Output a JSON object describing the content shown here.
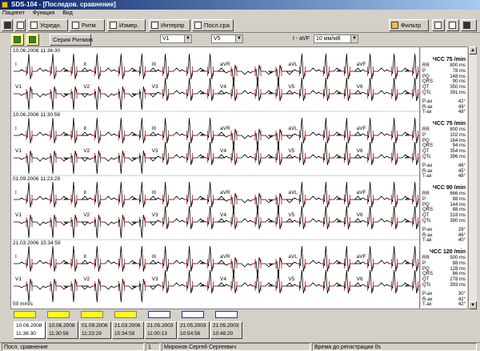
{
  "window": {
    "title": "SDS-104 - [Последов. сравнение]"
  },
  "menu": [
    "Пациент",
    "Функция",
    "Вид"
  ],
  "toolbar": {
    "btn_avg": "Усредн.",
    "btn_rhythm": "Ритм",
    "btn_measure": "Измер.",
    "btn_interpret": "Интерпр",
    "btn_seq": "Посл.сра",
    "btn_filter": "Фильтр"
  },
  "toolbar2": {
    "series_btn": "Серия Ритмов",
    "lead_a": "V1",
    "lead_b": "V5",
    "lead_range": "I - aVF",
    "gain": "10 мм/мВ"
  },
  "ecg": {
    "speed": "50 mm/s",
    "records": [
      {
        "date": "10.06.2008 11:36:30"
      },
      {
        "date": "10.06.2008 11:30:56"
      },
      {
        "date": "01.09.2006 11:23:29"
      },
      {
        "date": "21.03.2006 15:34:59"
      }
    ],
    "row_leads_top": [
      "I",
      "II",
      "III",
      "aVR",
      "aVL",
      "aVF"
    ],
    "row_leads_bottom": [
      "V1",
      "V2",
      "V3",
      "V4",
      "V5",
      "V6"
    ]
  },
  "measurements": [
    {
      "hr": "ЧСС  75 /min",
      "rows": [
        [
          "RR",
          "800 ms"
        ],
        [
          "P",
          "78 ms"
        ],
        [
          "PQ",
          "148 ms"
        ],
        [
          "QRS",
          "90 ms"
        ],
        [
          "QT",
          "350 ms"
        ],
        [
          "QTc",
          "391 ms"
        ]
      ],
      "axes": [
        [
          "P-ax",
          "42°"
        ],
        [
          "R-ax",
          "49°"
        ],
        [
          "T-ax",
          "48°"
        ]
      ]
    },
    {
      "hr": "ЧСС  75 /min",
      "rows": [
        [
          "RR",
          "800 ms"
        ],
        [
          "P",
          "102 ms"
        ],
        [
          "PQ",
          "164 ms"
        ],
        [
          "QRS",
          "94 ms"
        ],
        [
          "QT",
          "354 ms"
        ],
        [
          "QTc",
          "396 ms"
        ]
      ],
      "axes": [
        [
          "P-ax",
          "46°"
        ],
        [
          "R-ax",
          "45°"
        ],
        [
          "T-ax",
          "48°"
        ]
      ]
    },
    {
      "hr": "ЧСС  90 /min",
      "rows": [
        [
          "RR",
          "666 ms"
        ],
        [
          "P",
          "88 ms"
        ],
        [
          "PQ",
          "144 ms"
        ],
        [
          "QRS",
          "88 ms"
        ],
        [
          "QT",
          "318 ms"
        ],
        [
          "QTc",
          "390 ms"
        ]
      ],
      "axes": [
        [
          "P-ax",
          "28°"
        ],
        [
          "R-ax",
          "46°"
        ],
        [
          "T-ax",
          "40°"
        ]
      ]
    },
    {
      "hr": "ЧСС  120 /min",
      "rows": [
        [
          "RR",
          "500 ms"
        ],
        [
          "P",
          "88 ms"
        ],
        [
          "PQ",
          "128 ms"
        ],
        [
          "QRS",
          "86 ms"
        ],
        [
          "QT",
          "278 ms"
        ],
        [
          "QTc",
          "393 ms"
        ]
      ],
      "axes": [
        [
          "P-ax",
          "30°"
        ],
        [
          "R-ax",
          "42°"
        ],
        [
          "T-ax",
          "42°"
        ]
      ]
    }
  ],
  "swatch_colors": [
    "#ffff00",
    "#ffff00",
    "#ffff00",
    "#ffff00",
    "#ffffff",
    "#ffffff",
    "#ffffff"
  ],
  "tabs": [
    {
      "date": "10.06.2008",
      "time": "11:36:30"
    },
    {
      "date": "10.06.2008",
      "time": "11:30:56"
    },
    {
      "date": "01.09.2006",
      "time": "11:23:29"
    },
    {
      "date": "21.03.2006",
      "time": "15:34:59"
    },
    {
      "date": "21.05.2003",
      "time": "11:00:13"
    },
    {
      "date": "21.05.2003",
      "time": "10:54:56"
    },
    {
      "date": "21.05.2003",
      "time": "10:48:20"
    }
  ],
  "status": {
    "mode": "Посл. сравнение",
    "index": "1",
    "patient": "Миронов Сергей Сергеевич",
    "reg_time": "Время до регистрации 0s"
  }
}
